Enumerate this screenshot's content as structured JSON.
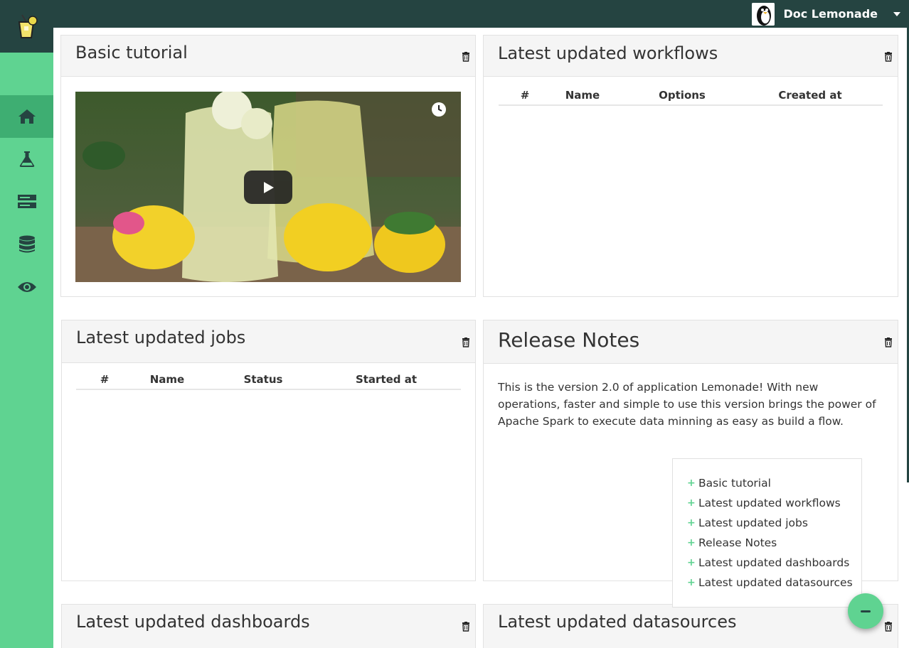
{
  "user": {
    "name": "Doc Lemonade"
  },
  "sidebar": {
    "items": [
      {
        "icon": "home-icon",
        "active": true
      },
      {
        "icon": "flask-icon",
        "active": false
      },
      {
        "icon": "server-icon",
        "active": false
      },
      {
        "icon": "database-icon",
        "active": false
      },
      {
        "icon": "eye-icon",
        "active": false
      }
    ]
  },
  "panels": {
    "tutorial": {
      "title": "Basic tutorial"
    },
    "workflows": {
      "title": "Latest updated workflows",
      "columns": [
        "#",
        "Name",
        "Options",
        "Created at"
      ]
    },
    "jobs": {
      "title": "Latest updated jobs",
      "columns": [
        "#",
        "Name",
        "Status",
        "Started at"
      ]
    },
    "release": {
      "title": "Release Notes",
      "text": "This is the version 2.0 of application Lemonade! With new operations, faster and simple to use this version brings the power of Apache Spark to execute data minning as easy as build a flow."
    },
    "dashboards": {
      "title": "Latest updated dashboards"
    },
    "datasources": {
      "title": "Latest updated datasources"
    }
  },
  "widget_menu": {
    "items": [
      "Basic tutorial",
      "Latest updated workflows",
      "Latest updated jobs",
      "Release Notes",
      "Latest updated dashboards",
      "Latest updated datasources"
    ]
  },
  "colors": {
    "sidebar": "#5fd391",
    "sidebar_active": "#3eae72",
    "topbar": "#254441"
  }
}
